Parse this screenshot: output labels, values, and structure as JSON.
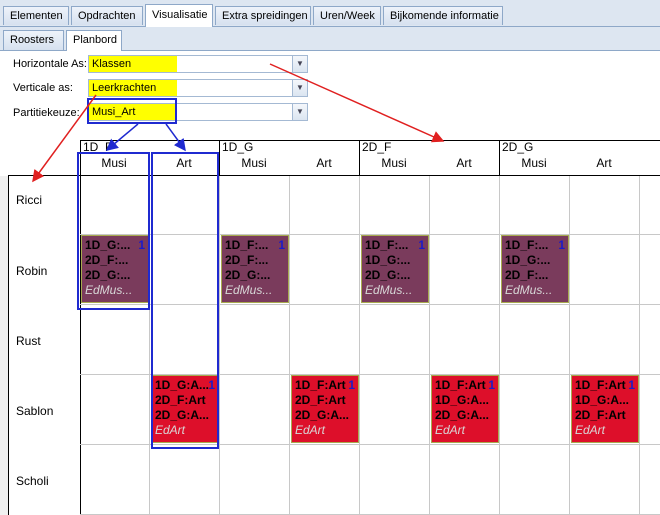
{
  "tabs": [
    "Elementen",
    "Opdrachten",
    "Visualisatie",
    "Extra spreidingen",
    "Uren/Week",
    "Bijkomende informatie"
  ],
  "subtabs": [
    "Roosters",
    "Planbord"
  ],
  "settings": {
    "horizontal_label": "Horizontale As:",
    "horizontal_value": "Klassen",
    "vertical_label": "Verticale as:",
    "vertical_value": "Leerkrachten",
    "partition_label": "Partitiekeuze:",
    "partition_value": "Musi_Art"
  },
  "grid": {
    "groups": [
      "1D_F",
      "1D_G",
      "2D_F",
      "2D_G"
    ],
    "subcolumns": [
      "Musi",
      "Art",
      "Musi",
      "Art",
      "Musi",
      "Art",
      "Musi",
      "Art"
    ],
    "rows": [
      "Ricci",
      "Robin",
      "Rust",
      "Sablon",
      "Scholi"
    ]
  },
  "cards": {
    "robin": [
      {
        "l1": "1D_G:...",
        "l2": "2D_F:...",
        "l3": "2D_G:...",
        "sub": "EdMus...",
        "num": "1"
      },
      {
        "l1": "1D_F:...",
        "l2": "2D_F:...",
        "l3": "2D_G:...",
        "sub": "EdMus...",
        "num": "1"
      },
      {
        "l1": "1D_F:...",
        "l2": "1D_G:...",
        "l3": "2D_G:...",
        "sub": "EdMus...",
        "num": "1"
      },
      {
        "l1": "1D_F:...",
        "l2": "1D_G:...",
        "l3": "2D_F:...",
        "sub": "EdMus...",
        "num": "1"
      }
    ],
    "sablon": [
      {
        "l1": "1D_G:A...",
        "l2": "2D_F:Art",
        "l3": "2D_G:A...",
        "sub": "EdArt",
        "num": "1"
      },
      {
        "l1": "1D_F:Art",
        "l2": "2D_F:Art",
        "l3": "2D_G:A...",
        "sub": "EdArt",
        "num": "1"
      },
      {
        "l1": "1D_F:Art",
        "l2": "1D_G:A...",
        "l3": "2D_G:A...",
        "sub": "EdArt",
        "num": "1"
      },
      {
        "l1": "1D_F:Art",
        "l2": "1D_G:A...",
        "l3": "2D_F:Art",
        "sub": "EdArt",
        "num": "1"
      }
    ]
  },
  "colors": {
    "highlight": "#ffff00",
    "musi_card": "#7a3b5c",
    "art_card": "#dd0f2a",
    "annotation_blue": "#1f2ad0",
    "annotation_red": "#e02020"
  },
  "icons": {
    "dropdown": "chevron-down-icon"
  }
}
